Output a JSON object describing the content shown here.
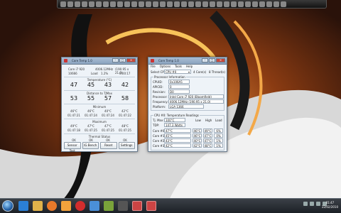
{
  "ct": {
    "title": "Core Temp 1.0",
    "model_label": "Core i7 920",
    "freq": "4006.12MHz",
    "ratio": "(190.95 x 21.0)",
    "id_val": "10666",
    "load_label": "Load",
    "load_val": "1.2%",
    "time_val": "0:00:17",
    "temp_header": "Temperature (°C)",
    "temps": [
      "47",
      "45",
      "43",
      "42"
    ],
    "tjmax_header": "Distance to TJMax",
    "dist": [
      "53",
      "55",
      "57",
      "58"
    ],
    "min_header": "Minimum",
    "min_vals": [
      "46°C",
      "46°C",
      "40°C",
      "42°C"
    ],
    "min_times": [
      "01:47:21",
      "01:47:24",
      "01:47:24",
      "01:47:22"
    ],
    "max_header": "Maximum",
    "max_vals": [
      "49°C",
      "47°C",
      "47°C",
      "48°C"
    ],
    "max_times": [
      "01:47:18",
      "01:47:25",
      "01:47:25",
      "01:47:25"
    ],
    "thermal_header": "Thermal Status",
    "thermal": [
      "OK",
      "OK",
      "OK",
      "OK"
    ],
    "buttons": [
      "Sensor Test",
      "IG Bench",
      "Reset",
      "Settings"
    ]
  },
  "cti": {
    "title": "Core Temp 1.0",
    "menu": [
      "File",
      "Options",
      "Tools",
      "Help"
    ],
    "select_cpu": "Select CPU:",
    "cpu_sel": "CPU #0",
    "cores_label": "4  Core(s)",
    "threads_label": "8  Thread(s)",
    "proc_info": "Processor Information",
    "fields": [
      {
        "k": "CPUID:",
        "v": "0x106A5"
      },
      {
        "k": "APICID:",
        "v": "0"
      },
      {
        "k": "Revision:",
        "v": "D0"
      },
      {
        "k": "Processor:",
        "v": "Intel Core i7 920 (Bloomfield)"
      },
      {
        "k": "Frequency:",
        "v": "4006.12MHz (190.95 x 21.0)"
      },
      {
        "k": "Platform:",
        "v": "LGA 1366"
      }
    ],
    "temps_header": "CPU #0: Temperature Readings",
    "tjmax_k": "Tj. Max:",
    "tjmax_v": "100°C",
    "tdp_k": "TDP:",
    "tdp_v": "147.3 Watts",
    "col_headers": [
      "Low",
      "High",
      "Load"
    ],
    "cores": [
      {
        "name": "Core #0:",
        "cur": "47°C",
        "low": "46°C",
        "high": "49°C",
        "load": "6%"
      },
      {
        "name": "Core #1:",
        "cur": "45°C",
        "low": "46°C",
        "high": "47°C",
        "load": "0%"
      },
      {
        "name": "Core #2:",
        "cur": "43°C",
        "low": "40°C",
        "high": "47°C",
        "load": "1%"
      },
      {
        "name": "Core #3:",
        "cur": "42°C",
        "low": "42°C",
        "high": "48°C",
        "load": "1%"
      }
    ]
  },
  "taskbar": {
    "time": "01:47",
    "date": "22/02/2010",
    "colors": {
      "ie": "#2b7fd6",
      "folder": "#e0b24a",
      "firefox": "#e8792a",
      "media": "#f2a23c",
      "opera": "#d22d2d",
      "other": "#4a8fd8"
    }
  }
}
